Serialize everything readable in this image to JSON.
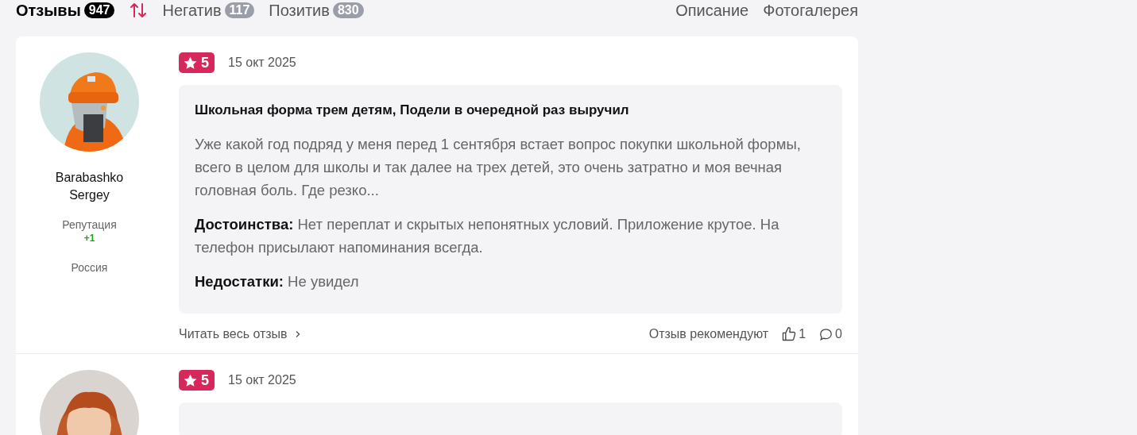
{
  "tabs": [
    {
      "label": "Отзывы",
      "count": "947",
      "selected": true
    },
    {
      "label": "Негатив",
      "count": "117",
      "selected": false
    },
    {
      "label": "Позитив",
      "count": "830",
      "selected": false
    }
  ],
  "links": [
    "Описание",
    "Фотогалерея"
  ],
  "reviews": [
    {
      "author": {
        "name": "Barabashko Sergey",
        "reputation_label": "Репутация",
        "reputation": "+1",
        "country": "Россия"
      },
      "rating": "5",
      "date": "15 окт 2025",
      "title": "Школьная форма трем детям, Подели в очередной раз выручил",
      "text": "Уже какой год подряд у меня перед 1 сентября встает вопрос покупки школьной формы, всего в целом для школы и так далее на трех детей, это очень затратно и моя вечная головная боль. Где резко...",
      "pros": "**Достоинства:** Нет переплат и скрытых непонятных условий. Приложение крутое. На телефон присылают напоминания всегда.",
      "cons": "**Недостатки:** Не увидел",
      "read_more": "Читать весь отзыв",
      "recommend_label": "Отзыв рекомендуют",
      "likes": "1",
      "comments": "0"
    },
    {
      "rating": "5",
      "date": "15 окт 2025"
    }
  ]
}
